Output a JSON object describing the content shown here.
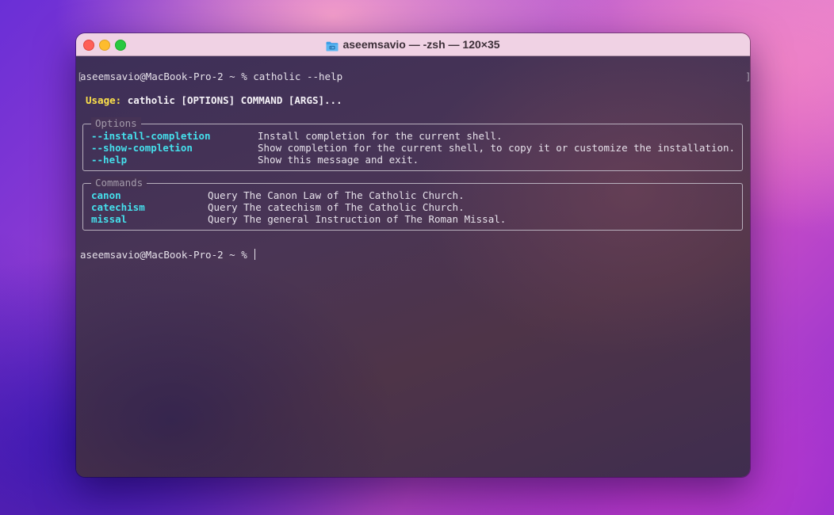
{
  "window": {
    "title": "aseemsavio — -zsh — 120×35"
  },
  "terminal": {
    "left_bracket": "[",
    "right_bracket": "]",
    "command_line": "aseemsavio@MacBook-Pro-2 ~ % catholic --help",
    "usage_label": "Usage:",
    "usage_text": "catholic [OPTIONS] COMMAND [ARGS]...",
    "options_title": "Options",
    "options": [
      {
        "flag": "--install-completion",
        "description": "Install completion for the current shell."
      },
      {
        "flag": "--show-completion",
        "description": "Show completion for the current shell, to copy it or customize the installation."
      },
      {
        "flag": "--help",
        "description": "Show this message and exit."
      }
    ],
    "commands_title": "Commands",
    "commands": [
      {
        "name": "canon",
        "description": "Query The Canon Law of The Catholic Church."
      },
      {
        "name": "catechism",
        "description": "Query The catechism of The Catholic Church."
      },
      {
        "name": "missal",
        "description": "Query The general Instruction of The Roman Missal."
      }
    ],
    "prompt": "aseemsavio@MacBook-Pro-2 ~ %"
  },
  "colors": {
    "option_accent": "#45e0ec",
    "usage_accent": "#fee24a",
    "close": "#fe5f57",
    "minimize": "#febc2e",
    "maximize": "#28c840"
  },
  "icons": {
    "title_icon": "folder-icon"
  }
}
